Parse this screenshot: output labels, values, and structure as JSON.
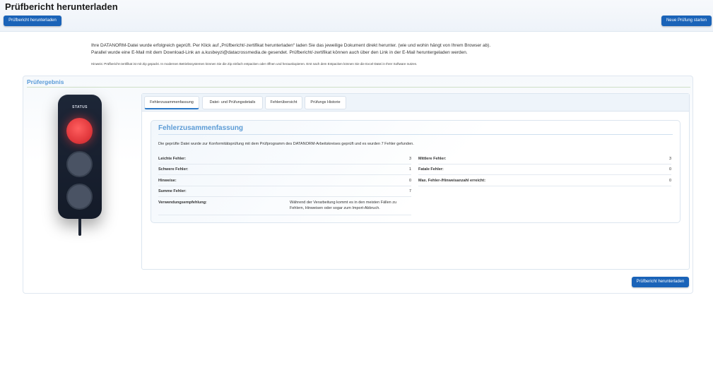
{
  "header": {
    "title": "Prüfbericht herunterladen",
    "download_button": "Prüfbericht herunterladen",
    "new_check_button": "Neue Prüfung starten"
  },
  "info": {
    "line1": "Ihre DATANORM-Datei wurde erfolgreich geprüft. Per Klick auf „Prüfbericht/-zertifikat herunterladen“ laden Sie das jeweilige Dokument direkt herunter. (wie und wohin hängt von Ihrem Browser ab).",
    "line2": "Parallel wurde eine E-Mail mit dem Download-Link an a.kusbeyzi@datacrossmedia.de gesendet. Prüfbericht/-zertifikat können auch über den Link in der E-Mail heruntergeladen werden.",
    "hint": "Hinweis: Prüfbericht-zertifikat ist mit Zip gepackt. In modernen Betriebssystemen können Sie die Zip einfach entpacken oder öffnen und herauskopieren. Erst nach dem Entpacken können Sie die Excel-Datei in Ihrer Software nutzen."
  },
  "result": {
    "title": "Prüfergebnis",
    "traffic_light": {
      "label": "STATUS",
      "active_lamp": "red",
      "colors": {
        "red": "#e2393d",
        "off": "#4a5364"
      }
    },
    "tabs": [
      {
        "label": "Fehlerzusammenfassung",
        "active": true
      },
      {
        "label": "Datei- und Prüfungsdetails",
        "active": false
      },
      {
        "label": "Fehlerübersicht",
        "active": false
      },
      {
        "label": "Prüfungs Historie",
        "active": false
      }
    ],
    "summary": {
      "title": "Fehlerzusammenfassung",
      "description": "Die geprüfte Datei wurde zur Konformitätsprüfung mit dem Prüfprogramm des DATANORM-Arbeitskreises geprüft und es wurden 7 Fehler gefunden.",
      "left_rows": [
        {
          "label": "Leichte Fehler:",
          "value": "3"
        },
        {
          "label": "Schwere Fehler:",
          "value": "1"
        },
        {
          "label": "Hinweise:",
          "value": "0"
        },
        {
          "label": "Summe Fehler:",
          "value": "7"
        }
      ],
      "right_rows": [
        {
          "label": "Mittlere Fehler:",
          "value": "3"
        },
        {
          "label": "Fatale Fehler:",
          "value": "0"
        },
        {
          "label": "Max. Fehler-/Hinweisanzahl erreicht:",
          "value": "0"
        }
      ],
      "recommendation": {
        "label": "Verwendungsempfehlung:",
        "text": "Während der Verarbeitung kommt es in den meisten Fällen zu Fehlern, Hinweisen oder sogar zum Import-Abbruch."
      }
    },
    "download_button": "Prüfbericht herunterladen"
  },
  "colors": {
    "accent": "#1a63b8",
    "title_blue": "#5b9bd5"
  }
}
